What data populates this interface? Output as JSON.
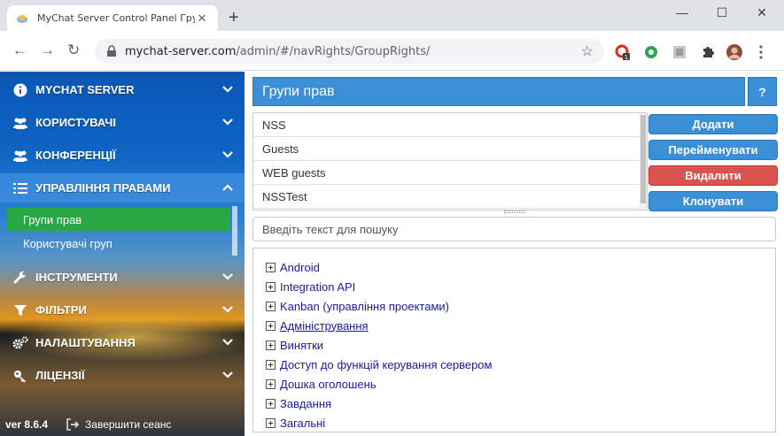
{
  "browser": {
    "tab_title": "MyChat Server Control Panel Гру",
    "url_host": "mychat-server.com",
    "url_path": "/admin/#/navRights/GroupRights/",
    "ext_badge": "1"
  },
  "sidebar": {
    "items": [
      {
        "label": "MYCHAT SERVER",
        "icon": "info-icon"
      },
      {
        "label": "КОРИСТУВАЧІ",
        "icon": "users-icon"
      },
      {
        "label": "КОНФЕРЕНЦІЇ",
        "icon": "conference-icon"
      },
      {
        "label": "УПРАВЛІННЯ ПРАВАМИ",
        "icon": "list-icon"
      },
      {
        "label": "ІНСТРУМЕНТИ",
        "icon": "wrench-icon"
      },
      {
        "label": "ФІЛЬТРИ",
        "icon": "filter-icon"
      },
      {
        "label": "НАЛАШТУВАННЯ",
        "icon": "gears-icon"
      },
      {
        "label": "ЛІЦЕНЗІЇ",
        "icon": "key-icon"
      }
    ],
    "subitems": [
      {
        "label": "Групи прав"
      },
      {
        "label": "Користувачі груп"
      }
    ],
    "version": "ver 8.6.4",
    "logout": "Завершити сеанс"
  },
  "main": {
    "title": "Групи прав",
    "help": "?",
    "groups": [
      "NSS",
      "Guests",
      "WEB guests",
      "NSSTest"
    ],
    "buttons": {
      "add": "Додати",
      "rename": "Перейменувати",
      "delete": "Видалити",
      "clone": "Клонувати"
    },
    "search_placeholder": "Введіть текст для пошуку",
    "tree": [
      "Android",
      "Integration API",
      "Kanban (управління проектами)",
      "Адміністрування",
      "Винятки",
      "Доступ до функцій керування сервером",
      "Дошка оголошень",
      "Завдання",
      "Загальні"
    ]
  },
  "colors": {
    "accent": "#3a8fd6",
    "danger": "#d9534f",
    "selected": "#27a844"
  }
}
